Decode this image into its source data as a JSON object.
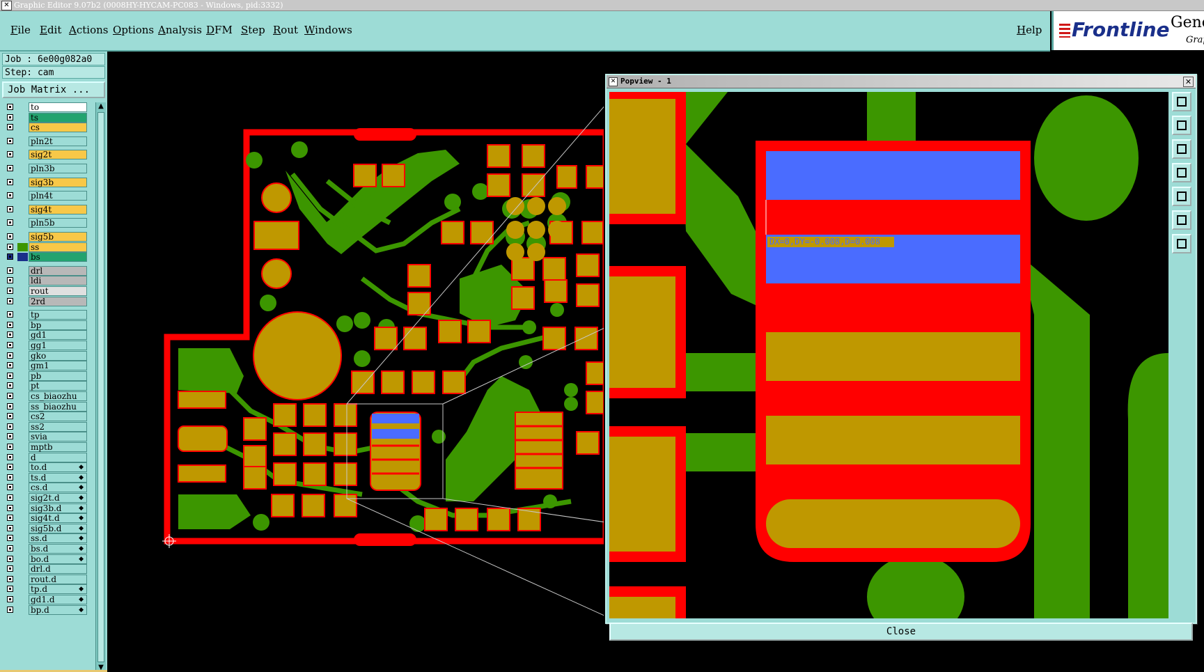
{
  "window": {
    "title": "Graphic Editor 9.07b2 (0008HY-HYCAM-PC083 - Windows, pid:3332)"
  },
  "menu": {
    "items": [
      "File",
      "Edit",
      "Actions",
      "Options",
      "Analysis",
      "DFM",
      "Step",
      "Rout",
      "Windows"
    ],
    "help": "Help"
  },
  "logo": {
    "brand": "Frontline",
    "product": "Gene",
    "sub": "Grap"
  },
  "job": {
    "job_line": "Job : 6e00g082a0",
    "step_line": "Step: cam",
    "matrix_button": "Job Matrix ..."
  },
  "colors": {
    "panel_bg": "#9ddcd6",
    "copper_red": "#ff0000",
    "pad_gold": "#bf9800",
    "trace_green": "#3c9600",
    "highlight_blue": "#4a6cff",
    "active_layer": "#23a36f"
  },
  "layers": [
    {
      "name": "to",
      "color": "#ffffff"
    },
    {
      "name": "ts",
      "color": "#23a36f"
    },
    {
      "name": "cs",
      "color": "#f8c848"
    },
    {
      "name": "pln2t",
      "color": "#9ddcd6",
      "gap": true
    },
    {
      "name": "sig2t",
      "color": "#f8c848",
      "gap": true
    },
    {
      "name": "pln3b",
      "color": "#9ddcd6",
      "gap": true
    },
    {
      "name": "sig3b",
      "color": "#f8c848",
      "gap": true
    },
    {
      "name": "pln4t",
      "color": "#9ddcd6",
      "gap": true
    },
    {
      "name": "sig4t",
      "color": "#f8c848",
      "gap": true
    },
    {
      "name": "pln5b",
      "color": "#9ddcd6",
      "gap": true
    },
    {
      "name": "sig5b",
      "color": "#f8c848",
      "gap": true
    },
    {
      "name": "ss",
      "color": "#f8c848"
    },
    {
      "name": "bs",
      "color": "#23a36f",
      "active": true
    },
    {
      "name": "drl",
      "color": "#b8b8b8",
      "gap": true
    },
    {
      "name": "ldi",
      "color": "#b8b8b8"
    },
    {
      "name": "rout",
      "color": "#e0e0e0"
    },
    {
      "name": "2rd",
      "color": "#b8b8b8"
    },
    {
      "name": "tp",
      "color": "#9ddcd6",
      "gap": true
    },
    {
      "name": "bp",
      "color": "#9ddcd6"
    },
    {
      "name": "gd1",
      "color": "#9ddcd6"
    },
    {
      "name": "gg1",
      "color": "#9ddcd6"
    },
    {
      "name": "gko",
      "color": "#9ddcd6"
    },
    {
      "name": "gm1",
      "color": "#9ddcd6"
    },
    {
      "name": "pb",
      "color": "#9ddcd6"
    },
    {
      "name": "pt",
      "color": "#9ddcd6"
    },
    {
      "name": "cs_biaozhu",
      "color": "#9ddcd6"
    },
    {
      "name": "ss_biaozhu",
      "color": "#9ddcd6"
    },
    {
      "name": "cs2",
      "color": "#9ddcd6"
    },
    {
      "name": "ss2",
      "color": "#9ddcd6"
    },
    {
      "name": "svia",
      "color": "#9ddcd6"
    },
    {
      "name": "mptb",
      "color": "#9ddcd6"
    },
    {
      "name": "d",
      "color": "#9ddcd6"
    },
    {
      "name": "to.d",
      "color": "#9ddcd6",
      "diff": true
    },
    {
      "name": "ts.d",
      "color": "#9ddcd6",
      "diff": true
    },
    {
      "name": "cs.d",
      "color": "#9ddcd6",
      "diff": true
    },
    {
      "name": "sig2t.d",
      "color": "#9ddcd6",
      "diff": true
    },
    {
      "name": "sig3b.d",
      "color": "#9ddcd6",
      "diff": true
    },
    {
      "name": "sig4t.d",
      "color": "#9ddcd6",
      "diff": true
    },
    {
      "name": "sig5b.d",
      "color": "#9ddcd6",
      "diff": true
    },
    {
      "name": "ss.d",
      "color": "#9ddcd6",
      "diff": true
    },
    {
      "name": "bs.d",
      "color": "#9ddcd6",
      "diff": true
    },
    {
      "name": "bo.d",
      "color": "#9ddcd6",
      "diff": true
    },
    {
      "name": "drl.d",
      "color": "#9ddcd6"
    },
    {
      "name": "rout.d",
      "color": "#9ddcd6"
    },
    {
      "name": "tp.d",
      "color": "#9ddcd6",
      "diff": true
    },
    {
      "name": "gd1.d",
      "color": "#9ddcd6",
      "diff": true
    },
    {
      "name": "bp.d",
      "color": "#9ddcd6",
      "diff": true
    }
  ],
  "popview": {
    "title": "Popview - 1",
    "measure": "DX=0,DY=-0.008,D=0.008",
    "close_label": "Close"
  }
}
